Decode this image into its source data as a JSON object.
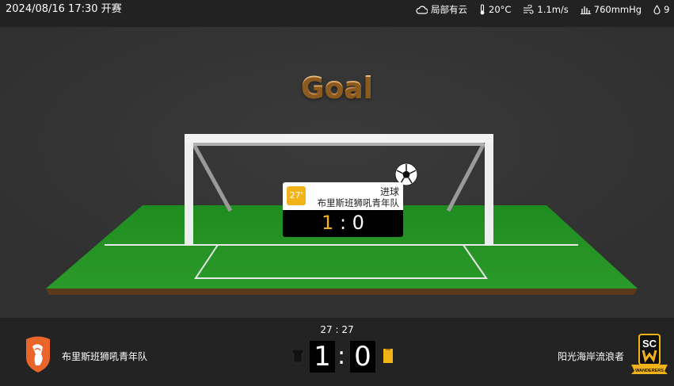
{
  "header": {
    "datetime": "2024/08/16 17:30 开赛",
    "weather": {
      "condition": "局部有云",
      "temperature": "20°C",
      "wind": "1.1m/s",
      "pressure": "760mmHg",
      "humidity": "9"
    }
  },
  "stage": {
    "title": "Goal",
    "event": {
      "minute": "27'",
      "type": "进球",
      "team": "布里斯班狮吼青年队",
      "score_home": "1",
      "score_sep": " : ",
      "score_away": "0"
    }
  },
  "match": {
    "clock": "27 : 27",
    "home_team": "布里斯班狮吼青年队",
    "away_team": "阳光海岸流浪者",
    "home_score": "1",
    "away_score": "0",
    "separator": ":",
    "away_logo_text": "SC",
    "away_logo_banner": "WANDERERS"
  },
  "colors": {
    "accent": "#f2b318",
    "home_logo": "#e9652a",
    "pitch": "#1e8a1e",
    "title": "#e58a2c"
  }
}
